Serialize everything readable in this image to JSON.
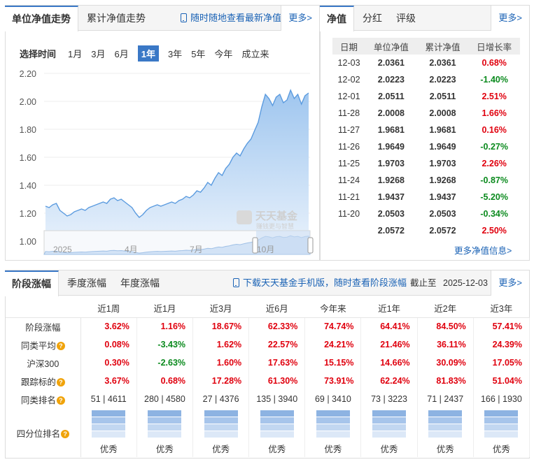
{
  "chart_tabs": {
    "active": "单位净值走势",
    "other": "累计净值走势",
    "promo": "随时随地查看最新净值",
    "more": "更多>"
  },
  "ranges": {
    "label": "选择时间",
    "items": [
      "1月",
      "3月",
      "6月",
      "1年",
      "3年",
      "5年",
      "今年",
      "成立来"
    ],
    "active": "1年"
  },
  "watermark": {
    "brand": "天天基金",
    "sub": "赚钱更与智慧"
  },
  "chart_data": {
    "type": "area",
    "ylim": [
      1.0,
      2.2
    ],
    "yticks": [
      "2.20",
      "2.00",
      "1.80",
      "1.60",
      "1.40",
      "1.20",
      "1.00"
    ],
    "navigator_labels": [
      "2025",
      "4月",
      "7月",
      "10月"
    ],
    "values": [
      1.25,
      1.24,
      1.26,
      1.27,
      1.22,
      1.2,
      1.18,
      1.19,
      1.21,
      1.22,
      1.23,
      1.22,
      1.24,
      1.25,
      1.26,
      1.27,
      1.28,
      1.27,
      1.3,
      1.31,
      1.29,
      1.3,
      1.28,
      1.26,
      1.24,
      1.2,
      1.17,
      1.19,
      1.22,
      1.24,
      1.25,
      1.26,
      1.25,
      1.26,
      1.27,
      1.28,
      1.27,
      1.29,
      1.3,
      1.32,
      1.31,
      1.33,
      1.36,
      1.35,
      1.38,
      1.42,
      1.4,
      1.45,
      1.49,
      1.47,
      1.52,
      1.55,
      1.6,
      1.63,
      1.61,
      1.66,
      1.7,
      1.73,
      1.79,
      1.85,
      1.96,
      2.05,
      2.02,
      1.97,
      2.03,
      2.05,
      1.99,
      2.01,
      2.08,
      2.02,
      2.05,
      1.98,
      2.04,
      2.06
    ],
    "colors": {
      "line": "#5b9bdf",
      "fill_top": "#9fc6ef",
      "fill_bottom": "#e6f0fb"
    }
  },
  "nav_tabs": {
    "active": "净值",
    "items": [
      "分红",
      "评级"
    ],
    "more": "更多>"
  },
  "nav_table": {
    "headers": [
      "日期",
      "单位净值",
      "累计净值",
      "日增长率"
    ],
    "rows": [
      [
        "12-03",
        "2.0361",
        "2.0361",
        "0.68%",
        "up"
      ],
      [
        "12-02",
        "2.0223",
        "2.0223",
        "-1.40%",
        "down"
      ],
      [
        "12-01",
        "2.0511",
        "2.0511",
        "2.51%",
        "up"
      ],
      [
        "11-28",
        "2.0008",
        "2.0008",
        "1.66%",
        "up"
      ],
      [
        "11-27",
        "1.9681",
        "1.9681",
        "0.16%",
        "up"
      ],
      [
        "11-26",
        "1.9649",
        "1.9649",
        "-0.27%",
        "down"
      ],
      [
        "11-25",
        "1.9703",
        "1.9703",
        "2.26%",
        "up"
      ],
      [
        "11-24",
        "1.9268",
        "1.9268",
        "-0.87%",
        "down"
      ],
      [
        "11-21",
        "1.9437",
        "1.9437",
        "-5.20%",
        "down"
      ],
      [
        "11-20",
        "2.0503",
        "2.0503",
        "-0.34%",
        "down"
      ],
      [
        "",
        "2.0572",
        "2.0572",
        "2.50%",
        "up"
      ]
    ],
    "more_link": "更多净值信息>"
  },
  "perf_tabs": {
    "active": "阶段涨幅",
    "items": [
      "季度涨幅",
      "年度涨幅"
    ],
    "promo": "下载天天基金手机版，随时查看阶段涨幅",
    "as_of_label": "截止至",
    "as_of": "2025-12-03",
    "more": "更多>"
  },
  "perf": {
    "columns": [
      "近1周",
      "近1月",
      "近3月",
      "近6月",
      "今年来",
      "近1年",
      "近2年",
      "近3年"
    ],
    "rows": [
      {
        "label": "阶段涨幅",
        "help": false,
        "values": [
          "3.62%",
          "1.16%",
          "18.67%",
          "62.33%",
          "74.74%",
          "64.41%",
          "84.50%",
          "57.41%"
        ],
        "dirs": [
          "up",
          "up",
          "up",
          "up",
          "up",
          "up",
          "up",
          "up"
        ]
      },
      {
        "label": "同类平均",
        "help": true,
        "values": [
          "0.08%",
          "-3.43%",
          "1.62%",
          "22.57%",
          "24.21%",
          "21.46%",
          "36.11%",
          "24.39%"
        ],
        "dirs": [
          "up",
          "down",
          "up",
          "up",
          "up",
          "up",
          "up",
          "up"
        ]
      },
      {
        "label": "沪深300",
        "help": false,
        "values": [
          "0.30%",
          "-2.63%",
          "1.60%",
          "17.63%",
          "15.15%",
          "14.66%",
          "30.09%",
          "17.05%"
        ],
        "dirs": [
          "up",
          "down",
          "up",
          "up",
          "up",
          "up",
          "up",
          "up"
        ]
      },
      {
        "label": "跟踪标的",
        "help": true,
        "values": [
          "3.67%",
          "0.68%",
          "17.28%",
          "61.30%",
          "73.91%",
          "62.24%",
          "81.83%",
          "51.04%"
        ],
        "dirs": [
          "up",
          "up",
          "up",
          "up",
          "up",
          "up",
          "up",
          "up"
        ]
      }
    ],
    "rank": {
      "label": "同类排名",
      "help": true,
      "values": [
        "51 | 4611",
        "280 | 4580",
        "27 | 4376",
        "135 | 3940",
        "69 | 3410",
        "73 | 3223",
        "71 | 2437",
        "166 | 1930"
      ]
    },
    "quartile": {
      "label": "四分位排名",
      "help": true,
      "values": [
        "优秀",
        "优秀",
        "优秀",
        "优秀",
        "优秀",
        "优秀",
        "优秀",
        "优秀"
      ],
      "colors": [
        "#8db3e2",
        "#a7c5eb",
        "#c2d7f1",
        "#dce8f7"
      ]
    }
  }
}
